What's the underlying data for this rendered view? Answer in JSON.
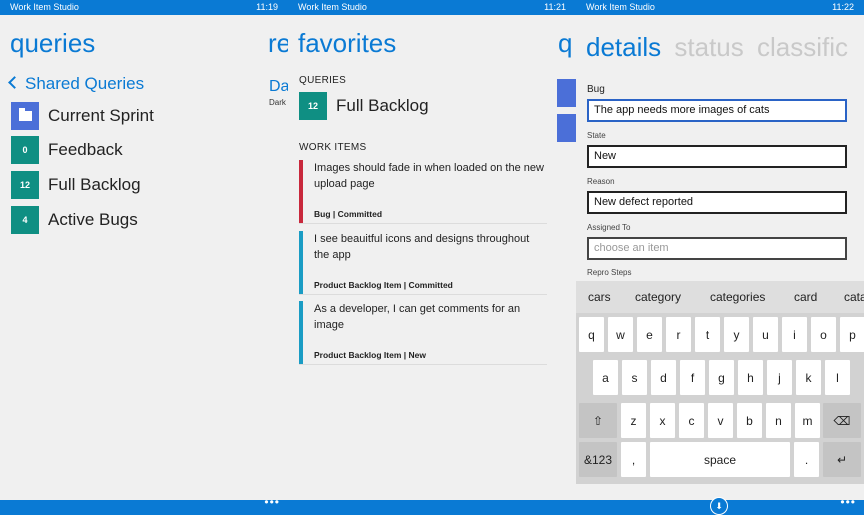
{
  "app_name": "Work Item Studio",
  "screen1": {
    "time": "11:19",
    "pivot_title": "queries",
    "pivot_peek": "re",
    "back_label": "Shared Queries",
    "items": [
      {
        "badge": "",
        "icon": "folder-icon",
        "label": "Current Sprint"
      },
      {
        "badge": "0",
        "label": "Feedback"
      },
      {
        "badge": "12",
        "label": "Full Backlog"
      },
      {
        "badge": "4",
        "label": "Active Bugs"
      }
    ],
    "peek_sub": "Da",
    "peek_sub2": "Dark"
  },
  "screen2": {
    "time": "11:21",
    "pivot_title": "favorites",
    "pivot_peek": "q",
    "queries_header": "QUERIES",
    "query": {
      "badge": "12",
      "label": "Full Backlog"
    },
    "work_items_header": "WORK ITEMS",
    "work_items": [
      {
        "title": "Images should fade in when loaded on the new upload page",
        "meta": "Bug | Committed",
        "color": "#c8283c"
      },
      {
        "title": "I see beauitful icons and designs throughout the app",
        "meta": "Product Backlog Item | Committed",
        "color": "#1a9cc4"
      },
      {
        "title": "As a developer, I can get comments for an image",
        "meta": "Product Backlog Item | New",
        "color": "#1a9cc4"
      }
    ]
  },
  "screen3": {
    "time": "11:22",
    "pivots": [
      "details",
      "status",
      "classific"
    ],
    "type_label": "Bug",
    "title_value": "The app needs more images of cats",
    "state_label": "State",
    "state_value": "New",
    "reason_label": "Reason",
    "reason_value": "New defect reported",
    "assigned_label": "Assigned To",
    "assigned_placeholder": "choose an item",
    "repro_label": "Repro Steps",
    "suggestions": [
      "cars",
      "category",
      "categories",
      "card",
      "cata"
    ],
    "row1": [
      "q",
      "w",
      "e",
      "r",
      "t",
      "y",
      "u",
      "i",
      "o",
      "p"
    ],
    "row2": [
      "a",
      "s",
      "d",
      "f",
      "g",
      "h",
      "j",
      "k",
      "l"
    ],
    "row3": [
      "z",
      "x",
      "c",
      "v",
      "b",
      "n",
      "m"
    ],
    "shift_key": "⇧",
    "backspace_key": "⌫",
    "num_key": "&123",
    "comma_key": ",",
    "space_key": "space",
    "period_key": ".",
    "enter_key": "↵",
    "save_icon": "save-icon"
  },
  "appbar_dots": "•••"
}
